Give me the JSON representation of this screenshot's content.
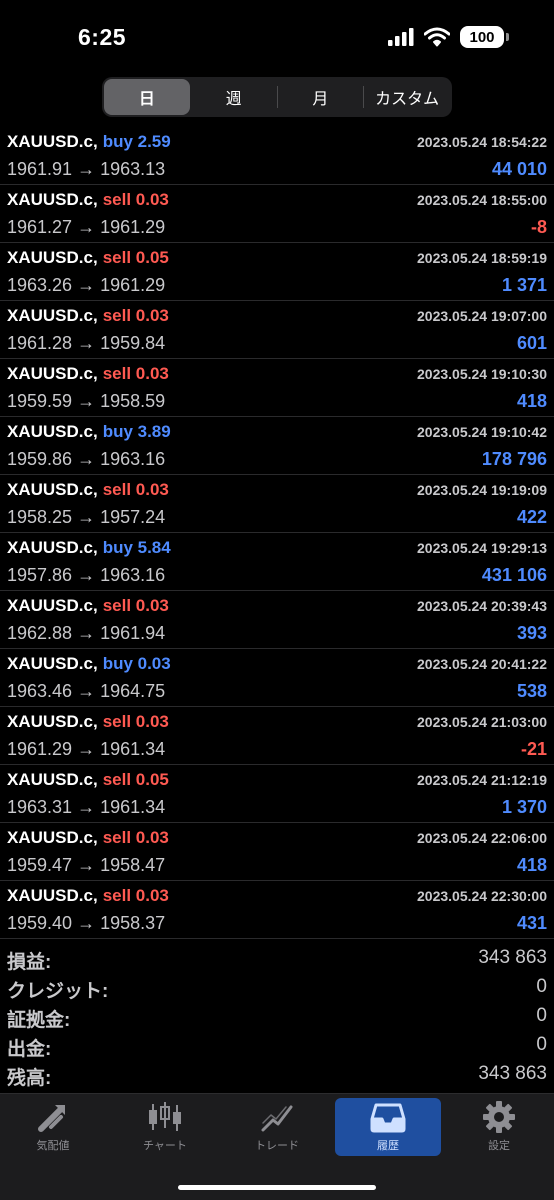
{
  "status_bar": {
    "time": "6:25",
    "battery": "100"
  },
  "segments": [
    {
      "label": "日",
      "active": true
    },
    {
      "label": "週",
      "active": false
    },
    {
      "label": "月",
      "active": false
    },
    {
      "label": "カスタム",
      "active": false
    }
  ],
  "trades": [
    {
      "symbol": "XAUUSD.c,",
      "side": "buy",
      "volume": "2.59",
      "time": "2023.05.24 18:54:22",
      "open": "1961.91",
      "close": "1963.13",
      "profit": "44 010"
    },
    {
      "symbol": "XAUUSD.c,",
      "side": "sell",
      "volume": "0.03",
      "time": "2023.05.24 18:55:00",
      "open": "1961.27",
      "close": "1961.29",
      "profit": "-8"
    },
    {
      "symbol": "XAUUSD.c,",
      "side": "sell",
      "volume": "0.05",
      "time": "2023.05.24 18:59:19",
      "open": "1963.26",
      "close": "1961.29",
      "profit": "1 371"
    },
    {
      "symbol": "XAUUSD.c,",
      "side": "sell",
      "volume": "0.03",
      "time": "2023.05.24 19:07:00",
      "open": "1961.28",
      "close": "1959.84",
      "profit": "601"
    },
    {
      "symbol": "XAUUSD.c,",
      "side": "sell",
      "volume": "0.03",
      "time": "2023.05.24 19:10:30",
      "open": "1959.59",
      "close": "1958.59",
      "profit": "418"
    },
    {
      "symbol": "XAUUSD.c,",
      "side": "buy",
      "volume": "3.89",
      "time": "2023.05.24 19:10:42",
      "open": "1959.86",
      "close": "1963.16",
      "profit": "178 796"
    },
    {
      "symbol": "XAUUSD.c,",
      "side": "sell",
      "volume": "0.03",
      "time": "2023.05.24 19:19:09",
      "open": "1958.25",
      "close": "1957.24",
      "profit": "422"
    },
    {
      "symbol": "XAUUSD.c,",
      "side": "buy",
      "volume": "5.84",
      "time": "2023.05.24 19:29:13",
      "open": "1957.86",
      "close": "1963.16",
      "profit": "431 106"
    },
    {
      "symbol": "XAUUSD.c,",
      "side": "sell",
      "volume": "0.03",
      "time": "2023.05.24 20:39:43",
      "open": "1962.88",
      "close": "1961.94",
      "profit": "393"
    },
    {
      "symbol": "XAUUSD.c,",
      "side": "buy",
      "volume": "0.03",
      "time": "2023.05.24 20:41:22",
      "open": "1963.46",
      "close": "1964.75",
      "profit": "538"
    },
    {
      "symbol": "XAUUSD.c,",
      "side": "sell",
      "volume": "0.03",
      "time": "2023.05.24 21:03:00",
      "open": "1961.29",
      "close": "1961.34",
      "profit": "-21"
    },
    {
      "symbol": "XAUUSD.c,",
      "side": "sell",
      "volume": "0.05",
      "time": "2023.05.24 21:12:19",
      "open": "1963.31",
      "close": "1961.34",
      "profit": "1 370"
    },
    {
      "symbol": "XAUUSD.c,",
      "side": "sell",
      "volume": "0.03",
      "time": "2023.05.24 22:06:00",
      "open": "1959.47",
      "close": "1958.47",
      "profit": "418"
    },
    {
      "symbol": "XAUUSD.c,",
      "side": "sell",
      "volume": "0.03",
      "time": "2023.05.24 22:30:00",
      "open": "1959.40",
      "close": "1958.37",
      "profit": "431"
    }
  ],
  "summary": [
    {
      "label": "損益:",
      "value": "343 863"
    },
    {
      "label": "クレジット:",
      "value": "0"
    },
    {
      "label": "証拠金:",
      "value": "0"
    },
    {
      "label": "出金:",
      "value": "0"
    },
    {
      "label": "残高:",
      "value": "343 863"
    }
  ],
  "tabs": [
    {
      "label": "気配値",
      "icon": "quotes-arrows-icon",
      "active": false
    },
    {
      "label": "チャート",
      "icon": "candlestick-chart-icon",
      "active": false
    },
    {
      "label": "トレード",
      "icon": "trade-line-icon",
      "active": false
    },
    {
      "label": "履歴",
      "icon": "history-inbox-icon",
      "active": true
    },
    {
      "label": "設定",
      "icon": "gear-icon",
      "active": false
    }
  ],
  "colors": {
    "buy": "#4f8bff",
    "sell": "#ff5a52",
    "active_tab": "#1f4fa0"
  }
}
